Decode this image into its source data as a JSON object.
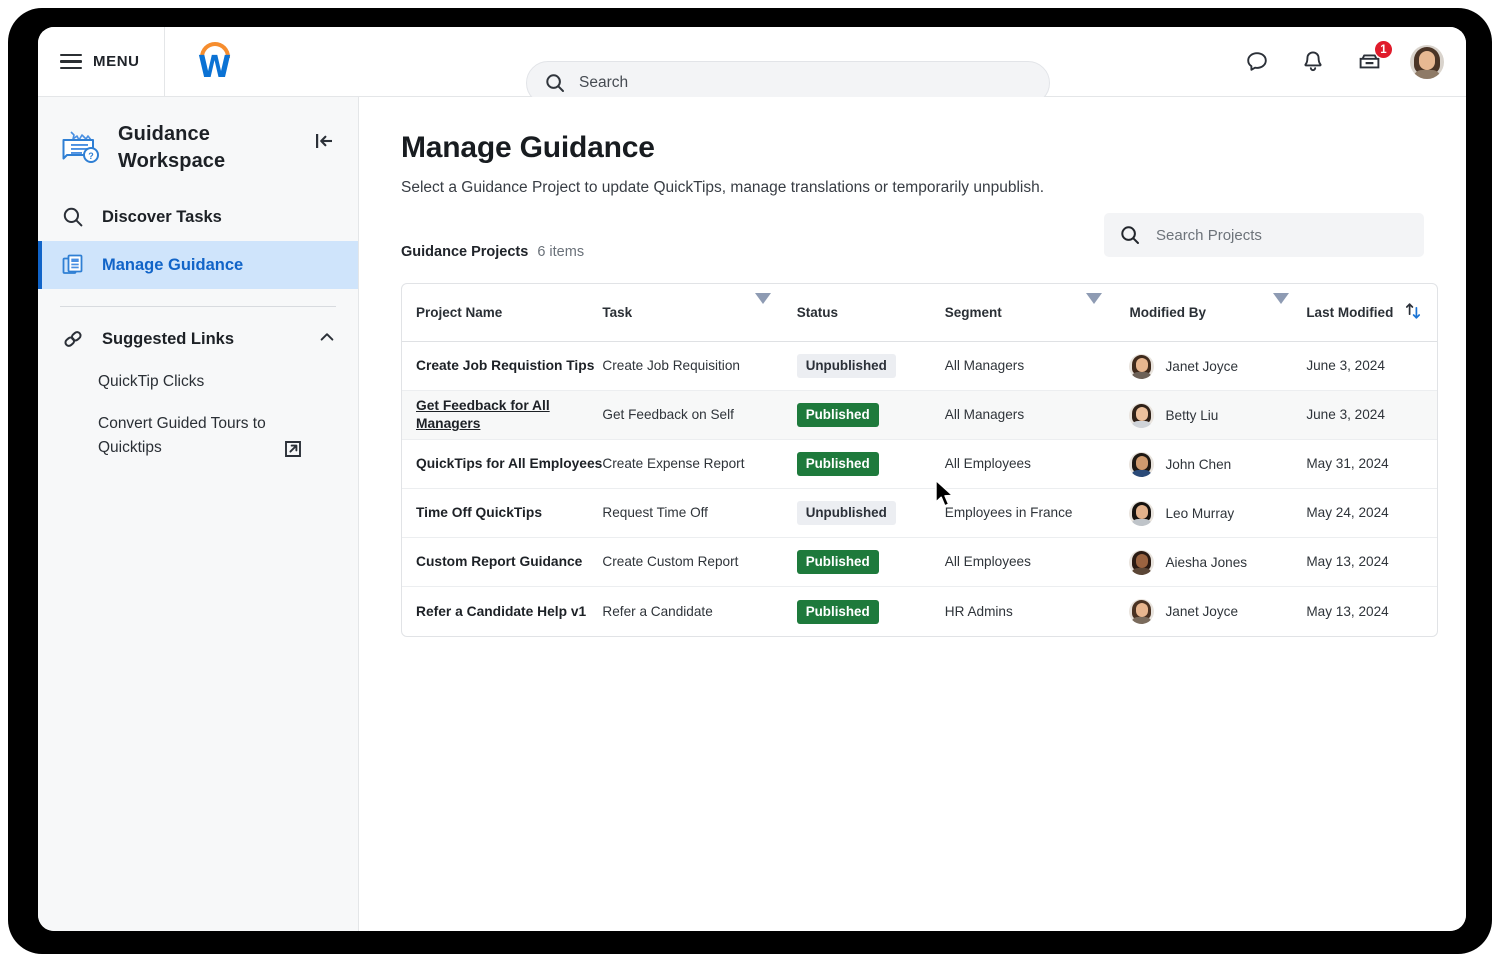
{
  "topbar": {
    "menu_label": "MENU",
    "logo_letter": "W",
    "search_placeholder": "Search",
    "icons": [
      {
        "name": "chat-icon"
      },
      {
        "name": "bell-icon"
      },
      {
        "name": "inbox-icon",
        "badge": "1"
      }
    ],
    "notification_badge": "1"
  },
  "sidebar": {
    "workspace_title": "Guidance Workspace",
    "collapse_icon": "collapse-panel-icon",
    "nav": [
      {
        "label": "Discover Tasks",
        "icon": "search-icon",
        "active": false
      },
      {
        "label": "Manage Guidance",
        "icon": "documents-icon",
        "active": true
      }
    ],
    "suggested": {
      "label": "Suggested Links",
      "icon": "link-icon",
      "chevron": "chevron-up-icon",
      "links": [
        {
          "label": "QuickTip Clicks",
          "external": false
        },
        {
          "label": "Convert Guided Tours to Quicktips",
          "external": true
        }
      ]
    }
  },
  "main": {
    "title": "Manage Guidance",
    "subtitle": "Select a Guidance Project to update QuickTips, manage translations or temporarily unpublish.",
    "list_caption": "Guidance Projects",
    "list_count": "6 items",
    "search_placeholder": "Search Projects"
  },
  "table": {
    "columns": [
      {
        "key": "name",
        "label": "Project Name",
        "sortable": false
      },
      {
        "key": "task",
        "label": "Task",
        "sortable": true
      },
      {
        "key": "status",
        "label": "Status",
        "sortable": true
      },
      {
        "key": "segment",
        "label": "Segment",
        "sortable": true
      },
      {
        "key": "modified_by",
        "label": "Modified By",
        "sortable": true
      },
      {
        "key": "last_modified",
        "label": "Last Modified",
        "sorted": true
      }
    ],
    "rows": [
      {
        "name": "Create Job Requistion Tips",
        "task": "Create Job Requisition",
        "status": "Unpublished",
        "segment": "All Managers",
        "modified_by": "Janet Joyce",
        "last_modified": "June 3, 2024",
        "hover": false,
        "link": false,
        "hair": "#3f2a1c",
        "skin": "#e7b68f",
        "body": "#6d6157"
      },
      {
        "name": "Get Feedback for All Managers",
        "task": "Get Feedback on Self",
        "status": "Published",
        "segment": "All Managers",
        "modified_by": "Betty Liu",
        "last_modified": "June 3, 2024",
        "hover": true,
        "link": true,
        "hair": "#2f2118",
        "skin": "#ecc09c",
        "body": "#cfd3d8"
      },
      {
        "name": "QuickTips for All Employees",
        "task": "Create Expense Report",
        "status": "Published",
        "segment": "All Employees",
        "modified_by": "John Chen",
        "last_modified": "May 31, 2024",
        "hover": false,
        "link": false,
        "hair": "#1e1813",
        "skin": "#cf9a6e",
        "body": "#2b4a78"
      },
      {
        "name": "Time Off QuickTips",
        "task": "Request Time Off",
        "status": "Unpublished",
        "segment": "Employees in France",
        "modified_by": "Leo Murray",
        "last_modified": "May 24, 2024",
        "hover": false,
        "link": false,
        "hair": "#15110e",
        "skin": "#e2b18b",
        "body": "#bfc4c9"
      },
      {
        "name": "Custom Report Guidance",
        "task": "Create Custom Report",
        "status": "Published",
        "segment": "All Employees",
        "modified_by": "Aiesha Jones",
        "last_modified": "May 13, 2024",
        "hover": false,
        "link": false,
        "hair": "#2a1a12",
        "skin": "#9a6340",
        "body": "#5b4636"
      },
      {
        "name": "Refer a Candidate Help v1",
        "task": "Refer a Candidate",
        "status": "Published",
        "segment": "HR Admins",
        "modified_by": "Janet Joyce",
        "last_modified": "May 13, 2024",
        "hover": false,
        "link": false,
        "hair": "#4a3222",
        "skin": "#e8b68f",
        "body": "#7a6b5c"
      }
    ]
  },
  "colors": {
    "accent_blue": "#1164c8",
    "brand_orange": "#f68d2e",
    "published_green": "#1e7a3c",
    "unpublished_grey": "#eceef2",
    "badge_red": "#e01b2b"
  }
}
